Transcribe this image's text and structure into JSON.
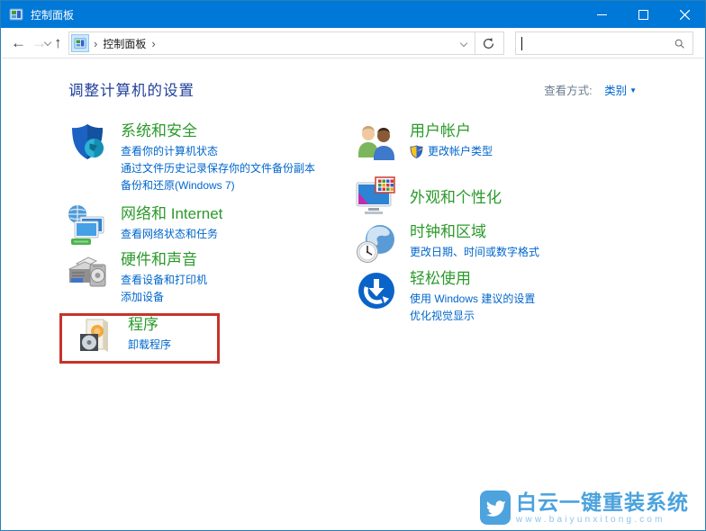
{
  "titlebar": {
    "title": "控制面板"
  },
  "nav": {
    "breadcrumb": {
      "root": "控制面板"
    },
    "search": {
      "value": "",
      "placeholder": ""
    }
  },
  "page": {
    "heading": "调整计算机的设置",
    "view_by": {
      "label": "查看方式:",
      "value": "类别"
    }
  },
  "categories": {
    "left": [
      {
        "title": "系统和安全",
        "links": [
          "查看你的计算机状态",
          "通过文件历史记录保存你的文件备份副本",
          "备份和还原(Windows 7)"
        ]
      },
      {
        "title": "网络和 Internet",
        "links": [
          "查看网络状态和任务"
        ]
      },
      {
        "title": "硬件和声音",
        "links": [
          "查看设备和打印机",
          "添加设备"
        ]
      },
      {
        "title": "程序",
        "links": [
          "卸载程序"
        ],
        "highlighted": true
      }
    ],
    "right": [
      {
        "title": "用户帐户",
        "links": [
          "更改帐户类型"
        ]
      },
      {
        "title": "外观和个性化",
        "links": []
      },
      {
        "title": "时钟和区域",
        "links": [
          "更改日期、时间或数字格式"
        ]
      },
      {
        "title": "轻松使用",
        "links": [
          "使用 Windows 建议的设置",
          "优化视觉显示"
        ]
      }
    ]
  },
  "watermark": {
    "name": "白云一键重装系统",
    "url": "www.baiyunxitong.com"
  },
  "icons": {
    "back": "←",
    "forward": "→",
    "up": "↑",
    "separator": "›",
    "dropdown": "▼"
  },
  "colors": {
    "titlebar": "#0078d7",
    "category_title": "#2b9a2b",
    "link": "#0066cc",
    "heading": "#21409a",
    "annotation_box": "#c5342c",
    "watermark": "#4da3de"
  }
}
